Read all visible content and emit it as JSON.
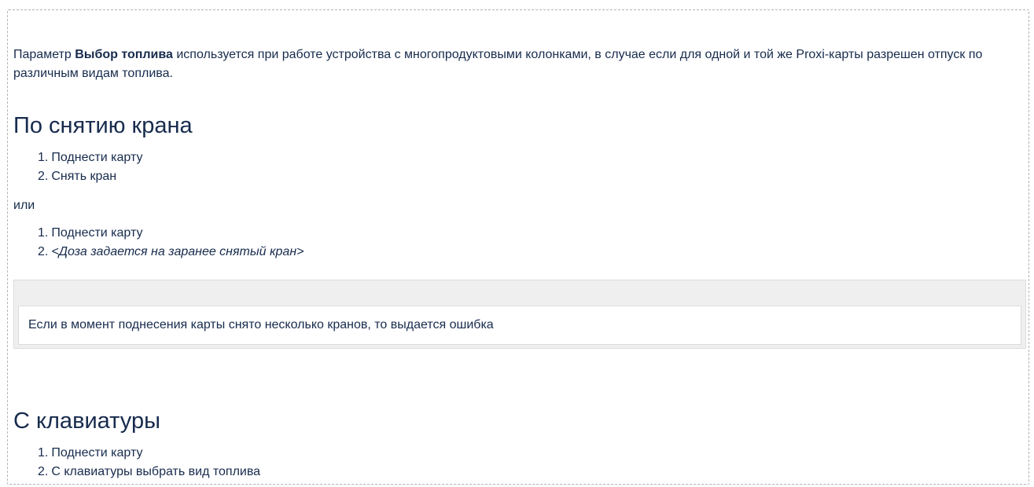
{
  "intro": {
    "text_before": "Параметр ",
    "bold": "Выбор топлива",
    "text_after": " используется при работе устройства с многопродуктовыми колонками, в случае если для одной и той же Proxi-карты разрешен отпуск по различным видам топлива."
  },
  "section_crane": {
    "heading": "По снятию крана",
    "steps_a": [
      {
        "num": "1.",
        "text": "Поднести карту"
      },
      {
        "num": "2.",
        "text": "Снять кран"
      }
    ],
    "or": "или",
    "steps_b": [
      {
        "num": "1.",
        "text": "Поднести карту"
      },
      {
        "num": "2.",
        "text": "<Доза задается на заранее снятый кран>"
      }
    ],
    "note": "Если в момент поднесения карты снято несколько кранов, то выдается ошибка"
  },
  "section_keyboard": {
    "heading": "С клавиатуры",
    "steps": [
      {
        "num": "1.",
        "text": "Поднести карту"
      },
      {
        "num": "2.",
        "text": "С клавиатуры выбрать вид топлива"
      }
    ]
  }
}
